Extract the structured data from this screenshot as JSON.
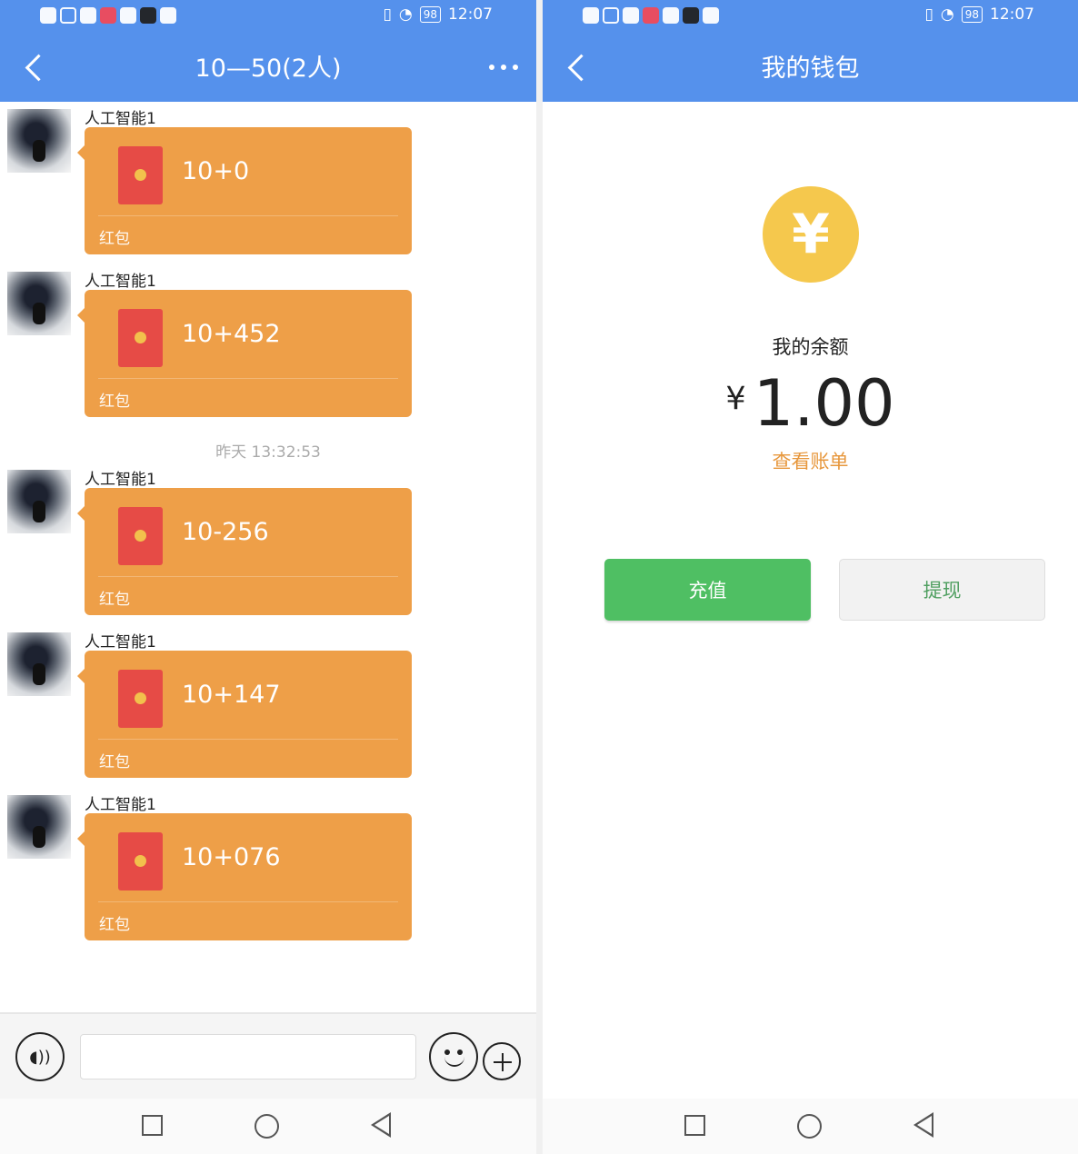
{
  "status": {
    "time": "12:07",
    "battery": "98"
  },
  "chat": {
    "title": "10—50(2人)",
    "timestamp": "昨天 13:32:53",
    "messages": [
      {
        "sender": "人工智能1",
        "packet": "10+0",
        "label": "红包"
      },
      {
        "sender": "人工智能1",
        "packet": "10+452",
        "label": "红包"
      },
      {
        "sender": "人工智能1",
        "packet": "10-256",
        "label": "红包"
      },
      {
        "sender": "人工智能1",
        "packet": "10+147",
        "label": "红包"
      },
      {
        "sender": "人工智能1",
        "packet": "10+076",
        "label": "红包"
      }
    ],
    "input_value": "",
    "voice_icon": "voice-icon",
    "emoji_icon": "smile-icon",
    "plus_icon": "plus-icon"
  },
  "wallet": {
    "title": "我的钱包",
    "balance_label": "我的余额",
    "currency": "¥",
    "amount": "1.00",
    "bill_link": "查看账单",
    "recharge": "充值",
    "withdraw": "提现",
    "icon_symbol": "¥"
  },
  "colors": {
    "header": "#5591ec",
    "packet": "#ee9f48",
    "recharge": "#4fbf63",
    "wallet_icon": "#f5c84d",
    "link": "#e7973c"
  }
}
